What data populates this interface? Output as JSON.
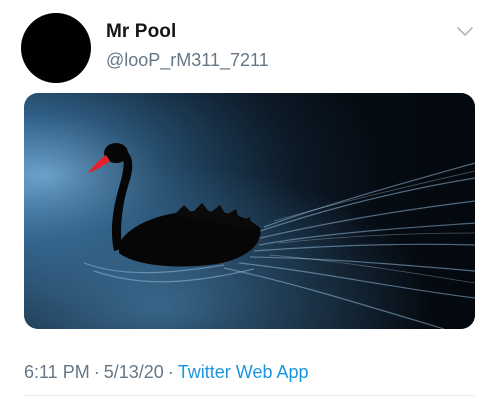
{
  "tweet": {
    "display_name": "Mr Pool",
    "handle": "@looP_rM311_7211",
    "menu_icon": "chevron-down-icon",
    "media": {
      "description_icon": "black-swan-photo",
      "colors": {
        "water_dark": "#0b1a2a",
        "water_light": "#5f93bd",
        "swan": "#060606",
        "beak": "#e5202b"
      }
    },
    "time": "6:11 PM",
    "date": "5/13/20",
    "separator": "·",
    "source": "Twitter Web App",
    "colors": {
      "name": "#14171a",
      "secondary": "#657786",
      "link": "#1b95e0"
    }
  }
}
